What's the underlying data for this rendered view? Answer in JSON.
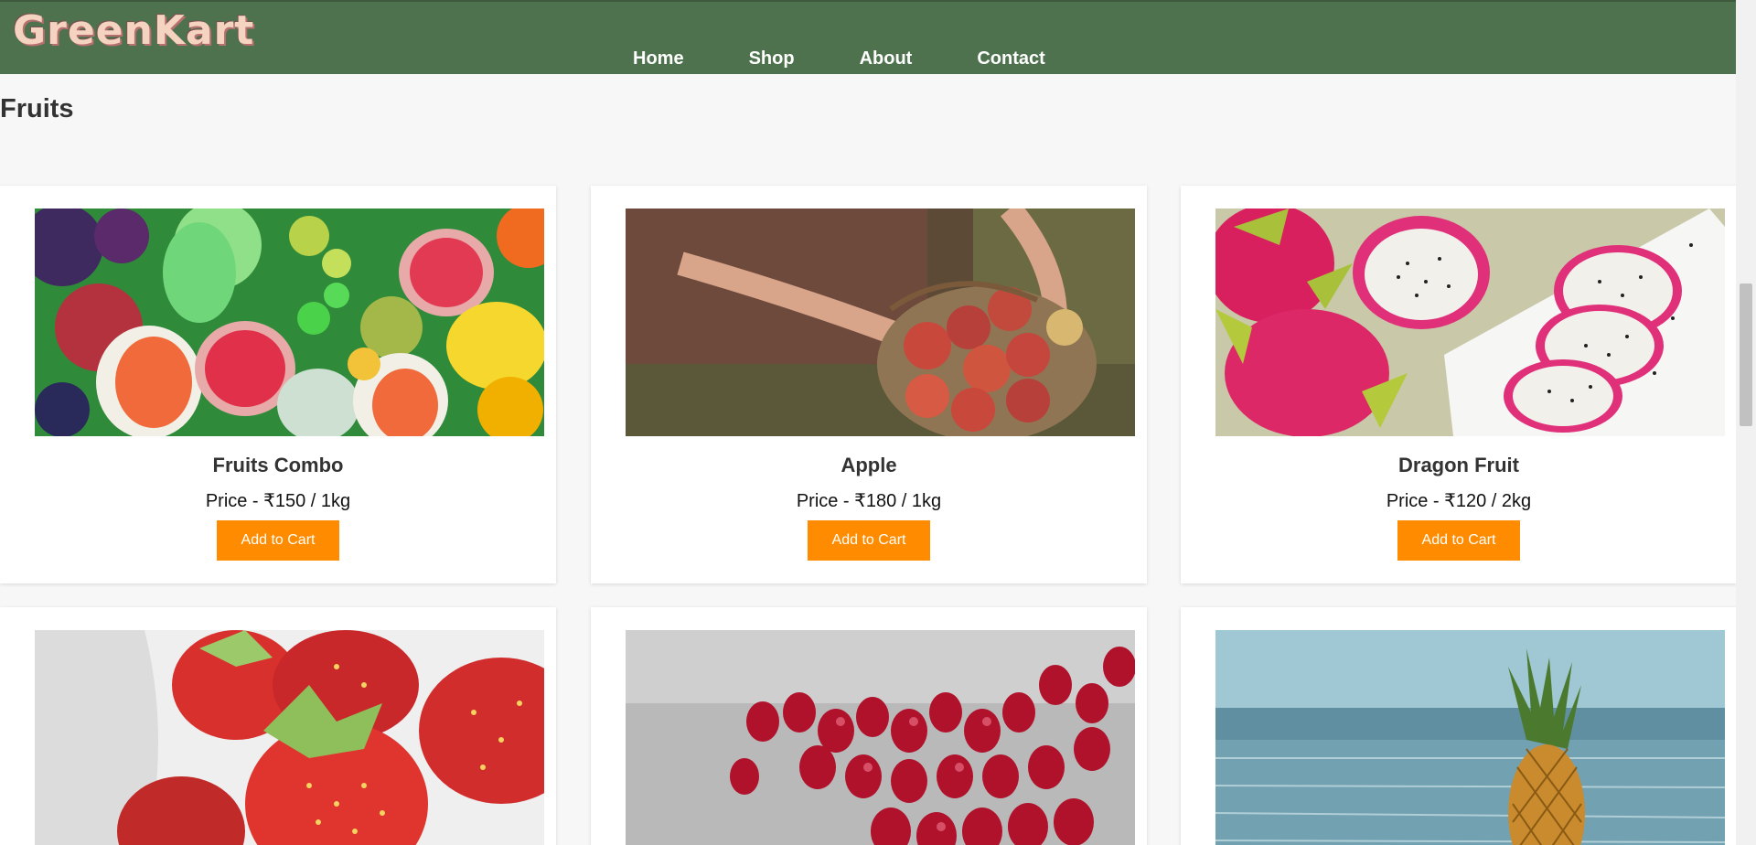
{
  "header": {
    "logo_text": "GreenKart",
    "nav": [
      "Home",
      "Shop",
      "About",
      "Contact"
    ]
  },
  "section": {
    "title": "Fruits"
  },
  "products": [
    {
      "name": "Fruits Combo",
      "price": "Price - ₹150 / 1kg",
      "button": "Add to Cart",
      "image": "fruits-combo-image"
    },
    {
      "name": "Apple",
      "price": "Price - ₹180 / 1kg",
      "button": "Add to Cart",
      "image": "apple-basket-image"
    },
    {
      "name": "Dragon Fruit",
      "price": "Price - ₹120 / 2kg",
      "button": "Add to Cart",
      "image": "dragon-fruit-image"
    },
    {
      "name": "",
      "price": "",
      "button": "",
      "image": "strawberry-image"
    },
    {
      "name": "",
      "price": "",
      "button": "",
      "image": "pomegranate-image"
    },
    {
      "name": "",
      "price": "",
      "button": "",
      "image": "pineapple-image"
    }
  ],
  "colors": {
    "header_bg": "#4d724d",
    "button_bg": "#ff8c00",
    "page_bg": "#f7f7f7"
  }
}
